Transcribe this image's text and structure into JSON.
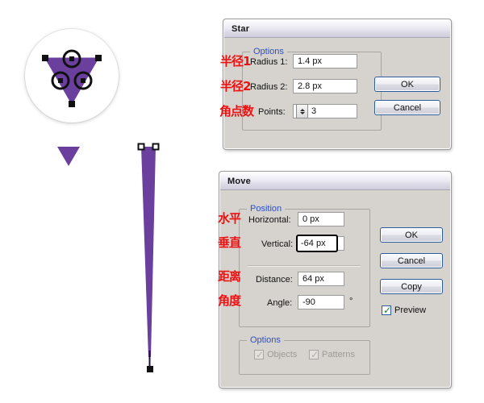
{
  "artwork": {
    "zoom_circle_name": "star-tool-preview",
    "triangle_fill": "#6b3f9e",
    "anchor_color": "#000000",
    "shapes": [
      {
        "name": "triangle-with-anchors",
        "label": "3-point star (triangle) with anchor points and direction handles"
      },
      {
        "name": "small-triangle",
        "label": "small purple downward triangle"
      },
      {
        "name": "tapered-spike",
        "label": "tall tapered purple spike"
      }
    ]
  },
  "star_dialog": {
    "title": "Star",
    "group_label": "Options",
    "fields": [
      {
        "label": "Radius 1:",
        "value": "1.4 px",
        "annotation": "半径1",
        "spinner": false
      },
      {
        "label": "Radius 2:",
        "value": "2.8 px",
        "annotation": "半径2",
        "spinner": false
      },
      {
        "label": "Points:",
        "value": "3",
        "annotation": "角点数",
        "spinner": true
      }
    ],
    "buttons": [
      {
        "label": "OK"
      },
      {
        "label": "Cancel"
      }
    ]
  },
  "move_dialog": {
    "title": "Move",
    "position_group_label": "Position",
    "options_group_label": "Options",
    "fields": [
      {
        "label": "Horizontal:",
        "value": "0 px",
        "annotation": "水平",
        "focused": false
      },
      {
        "label": "Vertical:",
        "value": "-64 px",
        "annotation": "垂直",
        "focused": true
      },
      {
        "label": "Distance:",
        "value": "64 px",
        "annotation": "距离",
        "focused": false
      },
      {
        "label": "Angle:",
        "value": "-90",
        "annotation": "角度",
        "focused": false
      }
    ],
    "angle_unit": "°",
    "buttons": [
      {
        "label": "OK"
      },
      {
        "label": "Cancel"
      },
      {
        "label": "Copy"
      }
    ],
    "preview_checkbox": {
      "label": "Preview",
      "checked": true,
      "enabled": true
    },
    "options_checkboxes": [
      {
        "label": "Objects",
        "checked": true,
        "enabled": false
      },
      {
        "label": "Patterns",
        "checked": true,
        "enabled": false
      }
    ]
  },
  "colors": {
    "dialog_background": "#d6d3ce",
    "group_label_blue": "#2a4fd0",
    "annotation_red": "#ee1111",
    "artwork_purple": "#6b3f9e",
    "button_border_blue": "#2d5c9e",
    "check_green": "#128a28"
  }
}
